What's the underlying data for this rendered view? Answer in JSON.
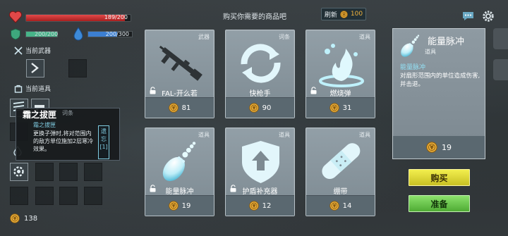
{
  "player": {
    "hp": {
      "current": 189,
      "max": 200,
      "text": "189/200"
    },
    "armor": {
      "current": 200,
      "max": 200,
      "text": "200/200"
    },
    "energy": {
      "current": 200,
      "max": 300,
      "text": "200/300"
    }
  },
  "left_panel": {
    "current_weapon_label": "当前武器",
    "current_item_label": "当前道具",
    "coins": "138"
  },
  "tooltip": {
    "title": "霜之拔匣",
    "category": "词条",
    "subtitle": "霜之拔匣",
    "description": "更换子弹时,将对范围内的敌方单位施加2层寒冷效果。",
    "tag": "遗忘[1]"
  },
  "header": {
    "title": "购买你需要的商品吧",
    "refresh_label": "刷新",
    "refresh_cost": "100"
  },
  "shop_items": [
    {
      "name": "FAL-开么若",
      "category": "武器",
      "price": "81",
      "icon": "rifle-icon"
    },
    {
      "name": "快枪手",
      "category": "词条",
      "price": "90",
      "icon": "reload-arrows-icon"
    },
    {
      "name": "燃烧弹",
      "category": "道具",
      "price": "31",
      "icon": "fire-icon"
    },
    {
      "name": "能量脉冲",
      "category": "道具",
      "price": "19",
      "icon": "energy-pulse-icon"
    },
    {
      "name": "护盾补充器",
      "category": "道具",
      "price": "12",
      "icon": "shield-up-icon"
    },
    {
      "name": "绷带",
      "category": "道具",
      "price": "14",
      "icon": "bandage-icon"
    }
  ],
  "detail": {
    "name": "能量脉冲",
    "category": "道具",
    "subtitle": "能量脉冲",
    "description": "对扇形范围内的单位造成伤害,并击退。",
    "price": "19"
  },
  "buttons": {
    "buy": "购买",
    "ready": "准备"
  },
  "colors": {
    "coin": "#f2b43d",
    "hp": "#d93a3a",
    "armor": "#47b489",
    "energy": "#3c7fd2",
    "buy": "#e5df3c",
    "ready": "#6bc84e",
    "accent": "#93e0f4"
  }
}
